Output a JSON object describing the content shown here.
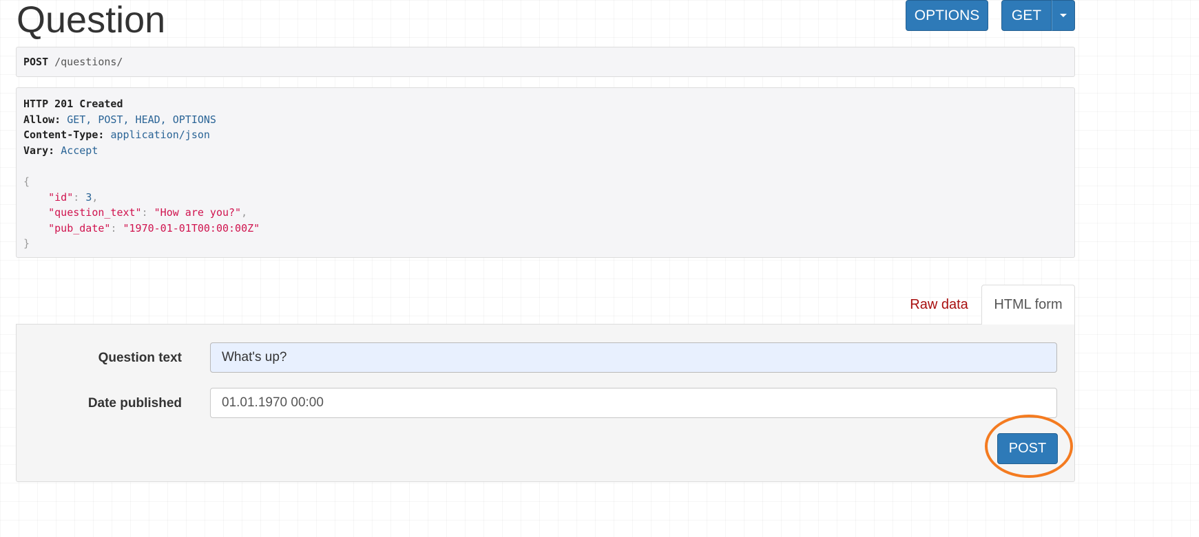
{
  "page": {
    "title": "Question"
  },
  "toolbar": {
    "options_label": "OPTIONS",
    "get_label": "GET"
  },
  "request": {
    "method": "POST",
    "path": "/questions/"
  },
  "response": {
    "status": "HTTP 201 Created",
    "headers": [
      {
        "key": "Allow:",
        "value": "GET, POST, HEAD, OPTIONS"
      },
      {
        "key": "Content-Type:",
        "value": "application/json"
      },
      {
        "key": "Vary:",
        "value": "Accept"
      }
    ],
    "body": {
      "open": "{",
      "close": "}",
      "fields": [
        {
          "key": "\"id\"",
          "value": "3",
          "type": "num",
          "comma": ","
        },
        {
          "key": "\"question_text\"",
          "value": "\"How are you?\"",
          "type": "str",
          "comma": ","
        },
        {
          "key": "\"pub_date\"",
          "value": "\"1970-01-01T00:00:00Z\"",
          "type": "str",
          "comma": ""
        }
      ]
    }
  },
  "tabs": {
    "raw_label": "Raw data",
    "html_label": "HTML form"
  },
  "form": {
    "question_label": "Question text",
    "question_value": "What's up?",
    "date_label": "Date published",
    "date_value": "01.01.1970 00:00",
    "submit_label": "POST"
  },
  "colors": {
    "primary": "#2e7ab8",
    "highlight": "#f47b20",
    "json_string": "#d0134e",
    "header_value": "#2a6496",
    "tab_active_text": "#a80e0e"
  }
}
